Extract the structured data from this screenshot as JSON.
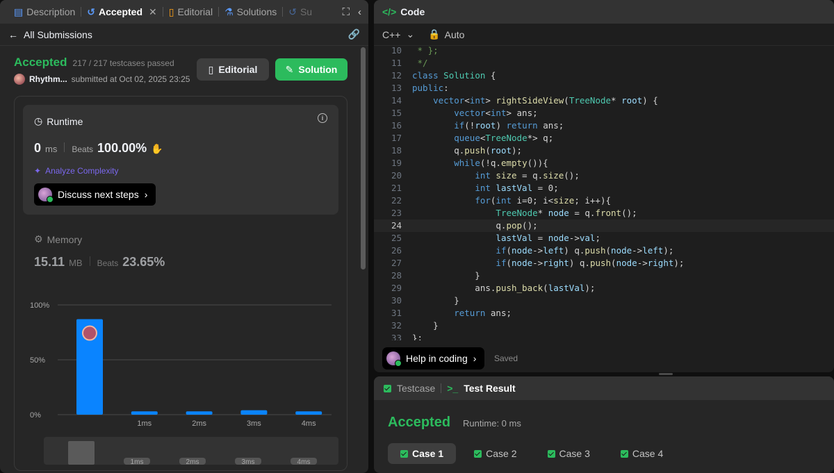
{
  "left": {
    "tabs": [
      {
        "label": "Description"
      },
      {
        "label": "Accepted"
      },
      {
        "label": "Editorial"
      },
      {
        "label": "Solutions"
      },
      {
        "label": "Su"
      }
    ],
    "back_label": "All Submissions",
    "status": "Accepted",
    "testcases": "217 / 217 testcases passed",
    "user": "Rhythm...",
    "submitted": "submitted at Oct 02, 2025 23:25",
    "editorial_btn": "Editorial",
    "solution_btn": "Solution",
    "runtime": {
      "label": "Runtime",
      "value": "0",
      "unit": "ms",
      "beats_label": "Beats",
      "beats": "100.00%",
      "analyze": "Analyze Complexity",
      "discuss": "Discuss next steps"
    },
    "memory": {
      "label": "Memory",
      "value": "15.11",
      "unit": "MB",
      "beats_label": "Beats",
      "beats": "23.65%"
    }
  },
  "chart_data": {
    "type": "bar",
    "categories": [
      "",
      "1ms",
      "2ms",
      "3ms",
      "4ms"
    ],
    "values": [
      87,
      3,
      3,
      4,
      3
    ],
    "ylabels": [
      "100%",
      "50%",
      "0%"
    ],
    "ylim": [
      0,
      100
    ],
    "bar_color": "#0a84ff"
  },
  "code": {
    "title": "Code",
    "language": "C++",
    "mode": "Auto",
    "help": "Help in coding",
    "saved": "Saved",
    "lines": [
      {
        "n": "10",
        "t": " * };"
      },
      {
        "n": "11",
        "t": " */"
      },
      {
        "n": "12",
        "t": "class Solution {"
      },
      {
        "n": "13",
        "t": "public:"
      },
      {
        "n": "14",
        "t": "    vector<int> rightSideView(TreeNode* root) {"
      },
      {
        "n": "15",
        "t": "        vector<int> ans;"
      },
      {
        "n": "16",
        "t": "        if(!root) return ans;"
      },
      {
        "n": "17",
        "t": "        queue<TreeNode*> q;"
      },
      {
        "n": "18",
        "t": "        q.push(root);"
      },
      {
        "n": "19",
        "t": "        while(!q.empty()){"
      },
      {
        "n": "20",
        "t": "            int size = q.size();"
      },
      {
        "n": "21",
        "t": "            int lastVal = 0;"
      },
      {
        "n": "22",
        "t": "            for(int i=0; i<size; i++){"
      },
      {
        "n": "23",
        "t": "                TreeNode* node = q.front();"
      },
      {
        "n": "24",
        "t": "                q.pop();"
      },
      {
        "n": "25",
        "t": "                lastVal = node->val;"
      },
      {
        "n": "26",
        "t": "                if(node->left) q.push(node->left);"
      },
      {
        "n": "27",
        "t": "                if(node->right) q.push(node->right);"
      },
      {
        "n": "28",
        "t": "            }"
      },
      {
        "n": "29",
        "t": "            ans.push_back(lastVal);"
      },
      {
        "n": "30",
        "t": "        }"
      },
      {
        "n": "31",
        "t": "        return ans;"
      },
      {
        "n": "32",
        "t": "    }"
      },
      {
        "n": "33",
        "t": "};"
      }
    ]
  },
  "result": {
    "tab_testcase": "Testcase",
    "tab_result": "Test Result",
    "status": "Accepted",
    "runtime": "Runtime: 0 ms",
    "cases": [
      "Case 1",
      "Case 2",
      "Case 3",
      "Case 4"
    ]
  }
}
